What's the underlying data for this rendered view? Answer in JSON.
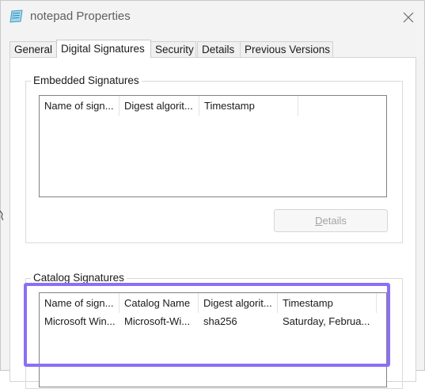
{
  "window": {
    "title": "notepad Properties",
    "app_icon": "notepad-icon",
    "close_icon": "close-icon"
  },
  "tabs": [
    {
      "label": "General",
      "active": false
    },
    {
      "label": "Digital Signatures",
      "active": true
    },
    {
      "label": "Security",
      "active": false
    },
    {
      "label": "Details",
      "active": false
    },
    {
      "label": "Previous Versions",
      "active": false
    }
  ],
  "embedded": {
    "group_label": "Embedded Signatures",
    "columns": [
      "Name of sign...",
      "Digest algorit...",
      "Timestamp"
    ],
    "rows": [],
    "details_button": {
      "prefix": "",
      "mnemonic": "D",
      "suffix": "etails",
      "enabled": false
    }
  },
  "catalog": {
    "group_label": "Catalog Signatures",
    "columns": [
      "Name of sign...",
      "Catalog Name",
      "Digest algorit...",
      "Timestamp"
    ],
    "rows": [
      [
        "Microsoft Win...",
        "Microsoft-Wi...",
        "sha256",
        "Saturday, Februa..."
      ]
    ]
  },
  "colors": {
    "highlight_border": "#8b6ff5",
    "disabled_text": "#a3a3a3"
  }
}
